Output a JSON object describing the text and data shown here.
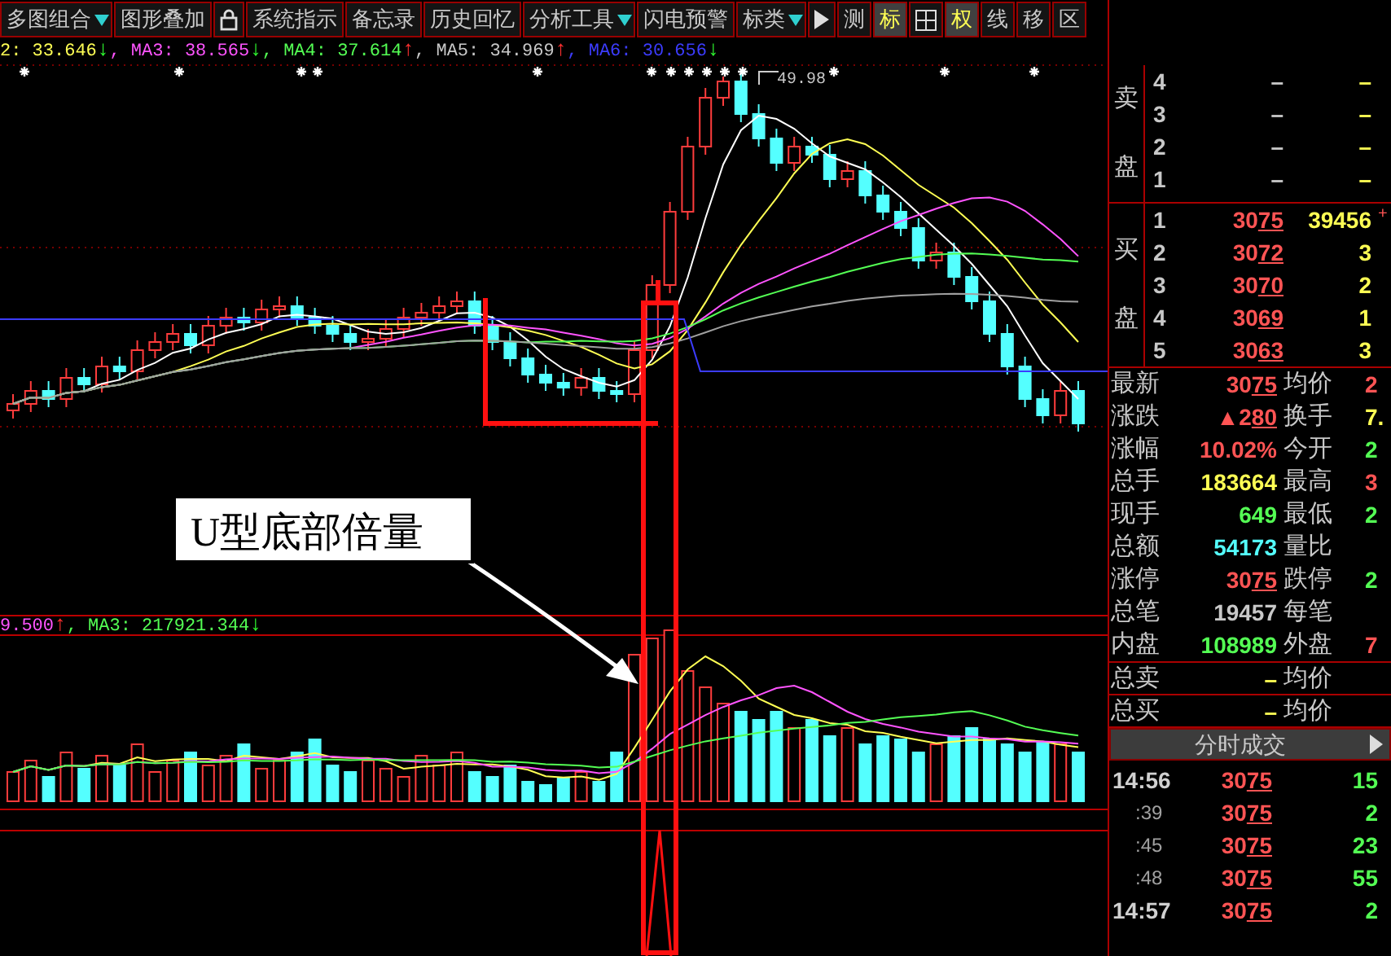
{
  "toolbar": [
    {
      "kind": "text",
      "label": "多图组合",
      "dropdown": true,
      "selected": false
    },
    {
      "kind": "text",
      "label": "图形叠加",
      "dropdown": false,
      "selected": false
    },
    {
      "kind": "lock",
      "selected": false
    },
    {
      "kind": "text",
      "label": "系统指示",
      "dropdown": false,
      "selected": false
    },
    {
      "kind": "text",
      "label": "备忘录",
      "dropdown": false,
      "selected": false
    },
    {
      "kind": "text",
      "label": "历史回忆",
      "dropdown": false,
      "selected": false
    },
    {
      "kind": "text",
      "label": "分析工具",
      "dropdown": true,
      "selected": false
    },
    {
      "kind": "text",
      "label": "闪电预警",
      "dropdown": false,
      "selected": false
    },
    {
      "kind": "text",
      "label": "标类",
      "dropdown": true,
      "selected": false
    },
    {
      "kind": "play",
      "selected": false
    },
    {
      "kind": "text",
      "label": "测",
      "dropdown": false,
      "selected": false
    },
    {
      "kind": "text",
      "label": "标",
      "dropdown": false,
      "selected": true
    },
    {
      "kind": "grid",
      "selected": false
    },
    {
      "kind": "text",
      "label": "权",
      "dropdown": false,
      "selected": true
    },
    {
      "kind": "text",
      "label": "线",
      "dropdown": false,
      "selected": false
    },
    {
      "kind": "text",
      "label": "移",
      "dropdown": false,
      "selected": false
    },
    {
      "kind": "text",
      "label": "区",
      "dropdown": false,
      "selected": false
    }
  ],
  "price_legend": [
    {
      "text": "2: 33.646",
      "color": "#ffff54",
      "arrow": {
        "text": "↓",
        "color": "#30ff30"
      }
    },
    {
      "text": ", MA3: 38.565",
      "color": "#ff54ff",
      "arrow": {
        "text": "↓",
        "color": "#30ff30"
      }
    },
    {
      "text": ", MA4: 37.614",
      "color": "#54ff54",
      "arrow": {
        "text": "↑",
        "color": "#ff3030"
      }
    },
    {
      "text": ", MA5: 34.969",
      "color": "#c8c8c8",
      "arrow": {
        "text": "↑",
        "color": "#ff3030"
      }
    },
    {
      "text": ", MA6: 30.656",
      "color": "#3c3cff",
      "arrow": {
        "text": "↓",
        "color": "#30ff30"
      }
    }
  ],
  "chart": {
    "peak_label": "49.98",
    "callout": "U型底部倍量"
  },
  "volume_legend": [
    {
      "text": "9.500",
      "color": "#ff54ff",
      "arrow": {
        "text": "↑",
        "color": "#ff3030"
      }
    },
    {
      "text": ", MA3: 217921.344",
      "color": "#54ff54",
      "arrow": {
        "text": "↓",
        "color": "#30ff30"
      }
    }
  ],
  "sell_side": {
    "label": "卖盘",
    "rows": [
      {
        "level": "4",
        "price": "–",
        "volume": "–"
      },
      {
        "level": "3",
        "price": "–",
        "volume": "–"
      },
      {
        "level": "2",
        "price": "–",
        "volume": "–"
      },
      {
        "level": "1",
        "price": "–",
        "volume": "–"
      }
    ]
  },
  "buy_side": {
    "label": "买盘",
    "rows": [
      {
        "level": "1",
        "price": "3075",
        "volume": "39456",
        "extra": "+"
      },
      {
        "level": "2",
        "price": "3072",
        "volume": "3"
      },
      {
        "level": "3",
        "price": "3070",
        "volume": "2"
      },
      {
        "level": "4",
        "price": "3069",
        "volume": "1"
      },
      {
        "level": "5",
        "price": "3063",
        "volume": "3"
      }
    ]
  },
  "stats": [
    {
      "left": {
        "label": "最新",
        "value": "3075",
        "color": "#ff5454",
        "underlined": true
      },
      "right": {
        "label": "均价",
        "value": "2",
        "color": "#ff5454"
      }
    },
    {
      "left": {
        "label": "涨跌",
        "value": "▲280",
        "color": "#ff5454",
        "underlined": true
      },
      "right": {
        "label": "换手",
        "value": "7.",
        "color": "#ffff54"
      }
    },
    {
      "left": {
        "label": "涨幅",
        "value": "10.02%",
        "color": "#ff5454",
        "underlined": false
      },
      "right": {
        "label": "今开",
        "value": "2",
        "color": "#54ff54"
      }
    },
    {
      "left": {
        "label": "总手",
        "value": "183664",
        "color": "#ffff54",
        "underlined": false
      },
      "right": {
        "label": "最高",
        "value": "3",
        "color": "#ff5454"
      }
    },
    {
      "left": {
        "label": "现手",
        "value": "649",
        "color": "#54ff54",
        "underlined": false
      },
      "right": {
        "label": "最低",
        "value": "2",
        "color": "#54ff54"
      }
    },
    {
      "left": {
        "label": "总额",
        "value": "54173",
        "color": "#54ffff",
        "underlined": false
      },
      "right": {
        "label": "量比"
      }
    },
    {
      "left": {
        "label": "涨停",
        "value": "3075",
        "color": "#ff5454",
        "underlined": true
      },
      "right": {
        "label": "跌停",
        "value": "2",
        "color": "#54ff54"
      }
    },
    {
      "left": {
        "label": "总笔",
        "value": "19457",
        "color": "#c8c8c8",
        "underlined": false
      },
      "right": {
        "label": "每笔"
      }
    },
    {
      "left": {
        "label": "内盘",
        "value": "108989",
        "color": "#54ff54",
        "underlined": false
      },
      "right": {
        "label": "外盘",
        "value": "7",
        "color": "#ff5454"
      }
    }
  ],
  "totals": [
    {
      "label": "总卖",
      "value": "–",
      "label2": "均价"
    },
    {
      "label": "总买",
      "value": "–",
      "label2": "均价"
    }
  ],
  "trades": {
    "title": "分时成交",
    "rows": [
      {
        "kind": "minute",
        "time": "14:56",
        "price": "3075",
        "volume": "15"
      },
      {
        "kind": "second",
        "time": ":39",
        "price": "3075",
        "volume": "2"
      },
      {
        "kind": "second",
        "time": ":45",
        "price": "3075",
        "volume": "23"
      },
      {
        "kind": "second",
        "time": ":48",
        "price": "3075",
        "volume": "55"
      },
      {
        "kind": "minute",
        "time": "14:57",
        "price": "3075",
        "volume": "2"
      }
    ]
  }
}
